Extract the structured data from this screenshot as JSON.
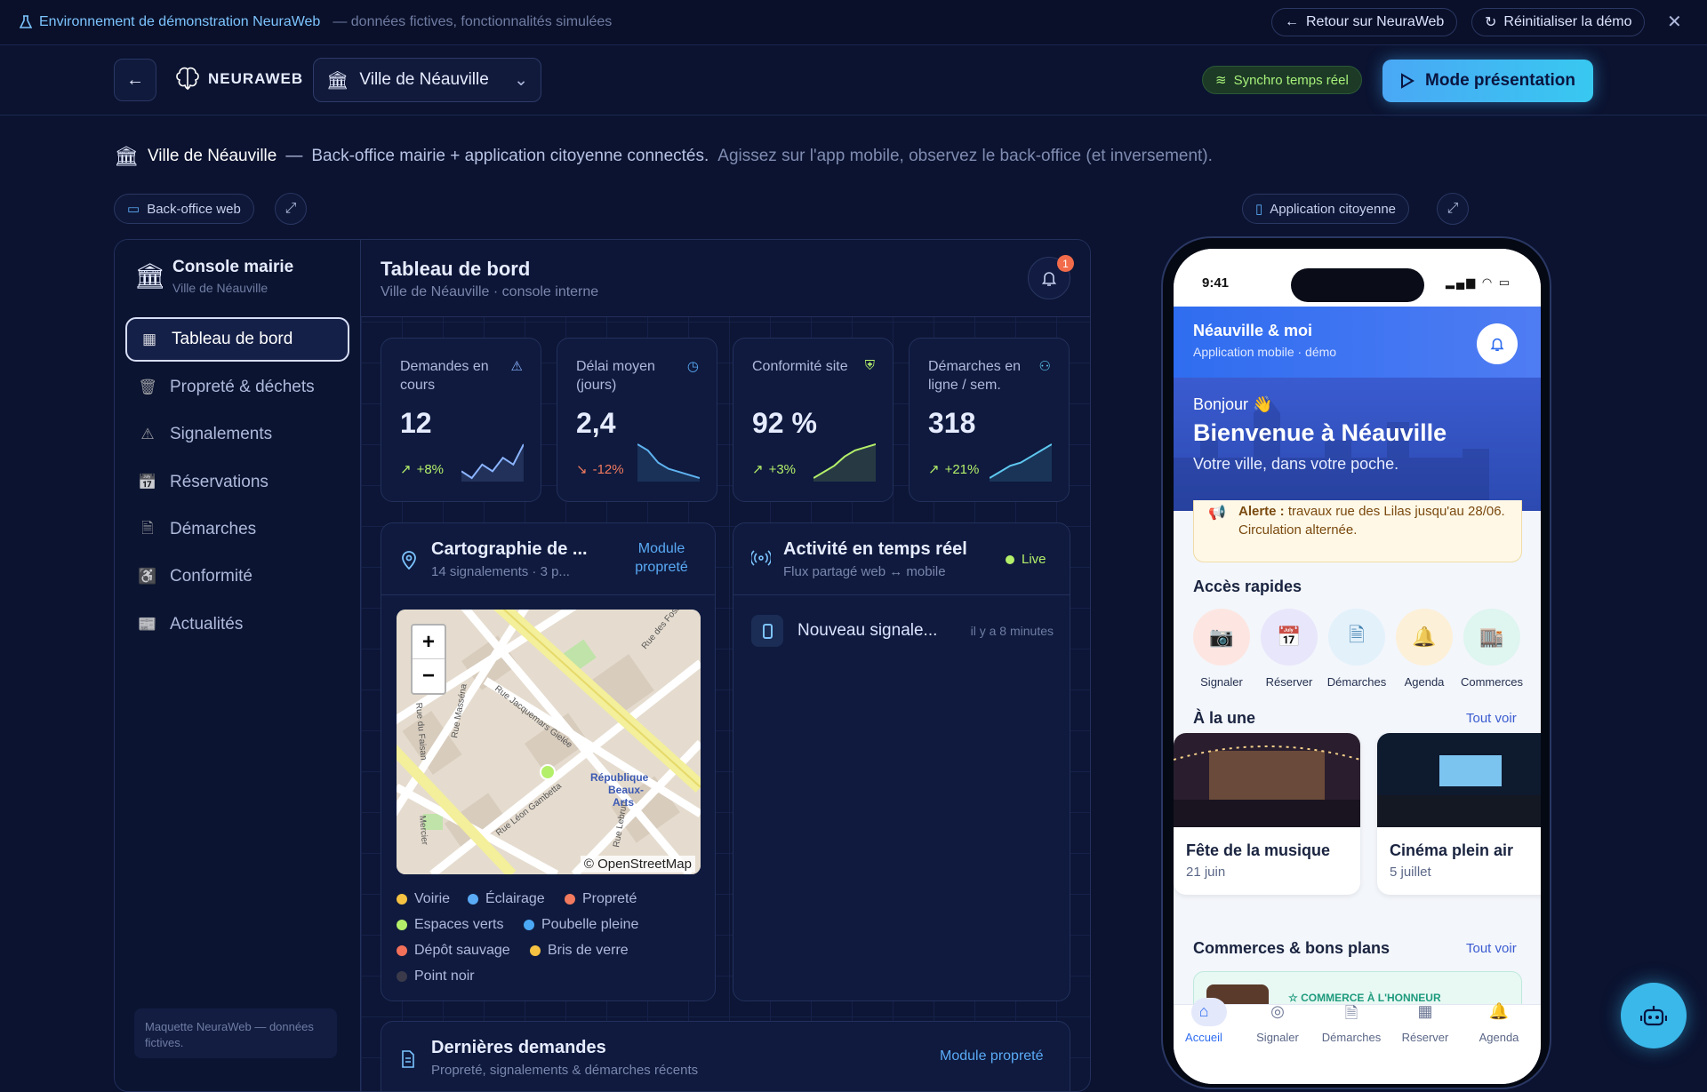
{
  "banner": {
    "title": "Environnement de démonstration NeuraWeb",
    "subtitle": "— données fictives, fonctionnalités simulées",
    "back_label": "Retour sur NeuraWeb",
    "reset_label": "Réinitialiser la démo"
  },
  "header": {
    "brand": "NEURAWEB",
    "city": "Ville de Néauville",
    "sync_label": "Synchro temps réel",
    "present_label": "Mode présentation"
  },
  "intro": {
    "city": "Ville de Néauville",
    "dash": "—",
    "text1": "Back-office mairie + application citoyenne connectés.",
    "text2": "Agissez sur l'app mobile, observez le back-office (et inversement)."
  },
  "views": {
    "web_label": "Back-office web",
    "mobile_label": "Application citoyenne"
  },
  "console": {
    "title": "Console mairie",
    "subtitle": "Ville de Néauville",
    "nav": [
      {
        "label": "Tableau de bord",
        "icon": "dashboard-icon"
      },
      {
        "label": "Propreté & déchets",
        "icon": "trash-icon"
      },
      {
        "label": "Signalements",
        "icon": "warning-icon"
      },
      {
        "label": "Réservations",
        "icon": "calendar-icon"
      },
      {
        "label": "Démarches",
        "icon": "document-icon"
      },
      {
        "label": "Conformité",
        "icon": "accessibility-icon"
      },
      {
        "label": "Actualités",
        "icon": "news-icon"
      }
    ],
    "footer": "Maquette NeuraWeb — données fictives."
  },
  "dashboard": {
    "title": "Tableau de bord",
    "subtitle": "Ville de Néauville · console interne",
    "notif_count": "1",
    "kpis": [
      {
        "label": "Demandes en cours",
        "value": "12",
        "change": "+8%",
        "trend": "up",
        "color": "#8bb4ff",
        "spark": [
          3,
          2,
          4,
          3,
          5,
          4,
          7
        ]
      },
      {
        "label": "Délai moyen (jours)",
        "value": "2,4",
        "change": "-12%",
        "trend": "down",
        "color": "#5fb3f0",
        "spark": [
          7,
          6,
          4,
          3,
          2.5,
          2,
          1.5
        ]
      },
      {
        "label": "Conformité site",
        "value": "92 %",
        "change": "+3%",
        "trend": "up",
        "color": "#b4ef6a",
        "spark": [
          1,
          2,
          3,
          4.5,
          5.5,
          6,
          6.5
        ]
      },
      {
        "label": "Démarches en ligne / sem.",
        "value": "318",
        "change": "+21%",
        "trend": "up",
        "color": "#5fc8f0",
        "spark": [
          1,
          2,
          3,
          3.5,
          4.5,
          5.5,
          6.5
        ]
      }
    ],
    "map": {
      "title": "Cartographie de ...",
      "subtitle": "14 signalements · 3 p...",
      "link": "Module propreté",
      "attribution": "© OpenStreetMap",
      "zoom_in": "+",
      "zoom_out": "−",
      "street_labels": [
        "Rue des Fossés",
        "Rue Masséna",
        "Rue Jacquemars Gielée",
        "Rue du Faisan",
        "Rue Léon Gambetta",
        "République Beaux-Arts",
        "Rue Lebrun",
        "Mercier"
      ],
      "legend": [
        {
          "label": "Voirie",
          "color": "#f5c242"
        },
        {
          "label": "Éclairage",
          "color": "#5aaaf5"
        },
        {
          "label": "Propreté",
          "color": "#f27a5e"
        },
        {
          "label": "Espaces verts",
          "color": "#b4ef6a"
        },
        {
          "label": "Poubelle pleine",
          "color": "#4aa8f5"
        },
        {
          "label": "Dépôt sauvage",
          "color": "#f2705a"
        },
        {
          "label": "Bris de verre",
          "color": "#f5c242"
        },
        {
          "label": "Point noir",
          "color": "#3a3a4a"
        }
      ]
    },
    "activity": {
      "title": "Activité en temps réel",
      "subtitle": "Flux partagé web ↔ mobile",
      "live": "Live",
      "items": [
        {
          "text": "Nouveau signale...",
          "time": "il y a 8 minutes"
        }
      ]
    },
    "requests": {
      "title": "Dernières demandes",
      "subtitle": "Propreté, signalements & démarches récents",
      "link": "Module propreté"
    }
  },
  "phone": {
    "time": "9:41",
    "app_title": "Néauville & moi",
    "app_subtitle": "Application mobile · démo",
    "greet": "Bonjour 👋",
    "welcome": "Bienvenue à Néauville",
    "tagline": "Votre ville, dans votre poche.",
    "alert_bold": "Alerte :",
    "alert_text": "travaux rue des Lilas jusqu'au 28/06. Circulation alternée.",
    "quick_title": "Accès rapides",
    "quick": [
      {
        "label": "Signaler",
        "bg": "#fde6e1",
        "fg": "#f07a62"
      },
      {
        "label": "Réserver",
        "bg": "#e8e6fb",
        "fg": "#5b52d9"
      },
      {
        "label": "Démarches",
        "bg": "#e3f1fb",
        "fg": "#2f88c8"
      },
      {
        "label": "Agenda",
        "bg": "#fdf0d8",
        "fg": "#e59a1a"
      },
      {
        "label": "Commerces",
        "bg": "#dff5ef",
        "fg": "#1e9b7d"
      }
    ],
    "news_title": "À la une",
    "see_all": "Tout voir",
    "events": [
      {
        "title": "Fête de la musique",
        "date": "21 juin"
      },
      {
        "title": "Cinéma plein air",
        "date": "5 juillet"
      }
    ],
    "shops_title": "Commerces & bons plans",
    "shop_badge": "COMMERCE À L'HONNEUR",
    "tabs": [
      "Accueil",
      "Signaler",
      "Démarches",
      "Réserver",
      "Agenda"
    ]
  }
}
